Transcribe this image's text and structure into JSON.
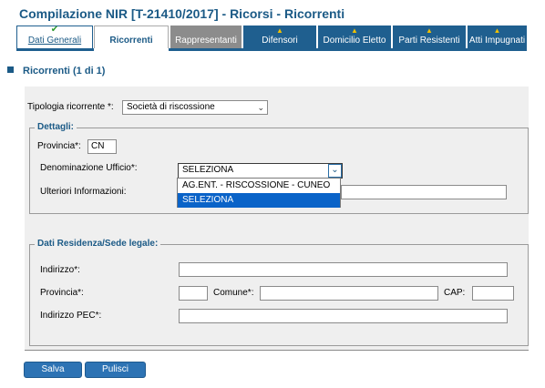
{
  "page_title": "Compilazione NIR [T-21410/2017] - Ricorsi - Ricorrenti",
  "tabs": [
    {
      "label": "Dati Generali",
      "icon": "check-icon",
      "state": "done"
    },
    {
      "label": "Ricorrenti",
      "icon": "",
      "state": "active"
    },
    {
      "label": "Rappresentanti",
      "icon": "",
      "state": "disabled"
    },
    {
      "label": "Difensori",
      "icon": "warning-icon",
      "state": "warning"
    },
    {
      "label": "Domicilio Eletto",
      "icon": "warning-icon",
      "state": "warning"
    },
    {
      "label": "Parti Resistenti",
      "icon": "warning-icon",
      "state": "warning"
    },
    {
      "label": "Atti Impugnati",
      "icon": "warning-icon",
      "state": "warning"
    }
  ],
  "section": {
    "title": "Ricorrenti (1 di 1)"
  },
  "form": {
    "tipologia_label": "Tipologia ricorrente *:",
    "tipologia_value": "Società di riscossione",
    "dettagli": {
      "legend": "Dettagli:",
      "provincia_label": "Provincia*:",
      "provincia_value": "CN",
      "ufficio_label": "Denominazione Ufficio*:",
      "ufficio_value": "SELEZIONA",
      "ulteriori_label": "Ulteriori Informazioni:",
      "ulteriori_value": "",
      "ufficio_options": [
        "AG.ENT. - RISCOSSIONE - CUNEO",
        "SELEZIONA"
      ],
      "ufficio_highlighted": "SELEZIONA"
    },
    "residenza": {
      "legend": "Dati Residenza/Sede legale:",
      "indirizzo_label": "Indirizzo*:",
      "indirizzo_value": "",
      "provincia_label": "Provincia*:",
      "provincia_value": "",
      "comune_label": "Comune*:",
      "comune_value": "",
      "cap_label": "CAP:",
      "cap_value": "",
      "pec_label": "Indirizzo PEC*:",
      "pec_value": ""
    }
  },
  "buttons": {
    "save": "Salva",
    "clear": "Pulisci"
  },
  "colors": {
    "brand": "#1b5a86",
    "tab_bg": "#1f5f8f",
    "tab_disabled": "#8c8c8c",
    "warning": "#f0c000",
    "check": "#2e9a2e",
    "highlight": "#0a63c8",
    "button": "#2d73b4",
    "panel": "#efefef"
  }
}
